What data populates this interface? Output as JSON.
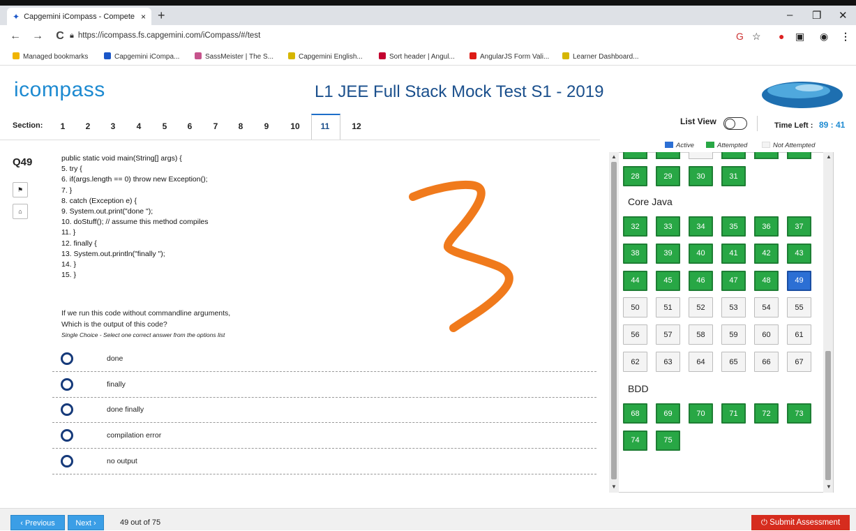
{
  "browser": {
    "tab_title": "Capgemini iCompass - Compete",
    "tab_close": "×",
    "new_tab": "+",
    "minimize": "–",
    "maximize": "❐",
    "close": "✕",
    "back": "←",
    "forward": "→",
    "reload": "C",
    "url": "https://icompass.fs.capgemini.com/iCompass/#/test",
    "bookmarks": [
      {
        "label": "Managed bookmarks",
        "color": "#f0b400"
      },
      {
        "label": "Capgemini iCompa...",
        "color": "#1a56c8"
      },
      {
        "label": "SassMeister | The S...",
        "color": "#c6538c"
      },
      {
        "label": "Capgemini English...",
        "color": "#d6b600"
      },
      {
        "label": "Sort header | Angul...",
        "color": "#c3002f"
      },
      {
        "label": "AngularJS Form Vali...",
        "color": "#dd1b16"
      },
      {
        "label": "Learner Dashboard...",
        "color": "#d6b600"
      }
    ]
  },
  "header": {
    "logo": "icompass",
    "title": "L1 JEE Full Stack Mock Test S1 - 2019"
  },
  "sections": {
    "label": "Section:",
    "items": [
      "1",
      "2",
      "3",
      "4",
      "5",
      "6",
      "7",
      "8",
      "9",
      "10",
      "11",
      "12"
    ],
    "active": "11"
  },
  "toolbar": {
    "list_view": "List View",
    "time_left_label": "Time Left :",
    "time_left_value": "89 : 41"
  },
  "question": {
    "number": "Q49",
    "code": [
      "public static void main(String[] args) {",
      "5. try {",
      "6. if(args.length == 0) throw new Exception();",
      "7. }",
      "8. catch (Exception e) {",
      "9. System.out.print(\"done \");",
      "10. doStuff(); // assume this method compiles",
      "11. }",
      "12. finally {",
      "13. System.out.println(\"finally \");",
      "14. }",
      "15. }"
    ],
    "text_line1": "If we run this code without commandline arguments,",
    "text_line2": "Which is the output of this code?",
    "hint": "Single Choice - Select one correct answer from the options list",
    "options": [
      "done",
      "finally",
      "done finally",
      "compilation error",
      "no output"
    ],
    "flag_icon": "flag-icon",
    "home_icon": "home-icon"
  },
  "palette": {
    "legend": {
      "active": "Active",
      "attempted": "Attempted",
      "not_attempted": "Not Attempted"
    },
    "colors": {
      "attempted": "#28a745",
      "active": "#2c6fd4",
      "not_attempted": "#f4f4f4"
    },
    "top_row": [
      "28",
      "29",
      "30",
      "31"
    ],
    "categories": [
      {
        "name": "Core Java",
        "rows": [
          [
            {
              "n": "32",
              "s": "att"
            },
            {
              "n": "33",
              "s": "att"
            },
            {
              "n": "34",
              "s": "att"
            },
            {
              "n": "35",
              "s": "att"
            },
            {
              "n": "36",
              "s": "att"
            },
            {
              "n": "37",
              "s": "att"
            }
          ],
          [
            {
              "n": "38",
              "s": "att"
            },
            {
              "n": "39",
              "s": "att"
            },
            {
              "n": "40",
              "s": "att"
            },
            {
              "n": "41",
              "s": "att"
            },
            {
              "n": "42",
              "s": "att"
            },
            {
              "n": "43",
              "s": "att"
            }
          ],
          [
            {
              "n": "44",
              "s": "att"
            },
            {
              "n": "45",
              "s": "att"
            },
            {
              "n": "46",
              "s": "att"
            },
            {
              "n": "47",
              "s": "att"
            },
            {
              "n": "48",
              "s": "att"
            },
            {
              "n": "49",
              "s": "act"
            }
          ],
          [
            {
              "n": "50",
              "s": "not"
            },
            {
              "n": "51",
              "s": "not"
            },
            {
              "n": "52",
              "s": "not"
            },
            {
              "n": "53",
              "s": "not"
            },
            {
              "n": "54",
              "s": "not"
            },
            {
              "n": "55",
              "s": "not"
            }
          ],
          [
            {
              "n": "56",
              "s": "not"
            },
            {
              "n": "57",
              "s": "not"
            },
            {
              "n": "58",
              "s": "not"
            },
            {
              "n": "59",
              "s": "not"
            },
            {
              "n": "60",
              "s": "not"
            },
            {
              "n": "61",
              "s": "not"
            }
          ],
          [
            {
              "n": "62",
              "s": "not"
            },
            {
              "n": "63",
              "s": "not"
            },
            {
              "n": "64",
              "s": "not"
            },
            {
              "n": "65",
              "s": "not"
            },
            {
              "n": "66",
              "s": "not"
            },
            {
              "n": "67",
              "s": "not"
            }
          ]
        ]
      },
      {
        "name": "BDD",
        "rows": [
          [
            {
              "n": "68",
              "s": "att"
            },
            {
              "n": "69",
              "s": "att"
            },
            {
              "n": "70",
              "s": "att"
            },
            {
              "n": "71",
              "s": "att"
            },
            {
              "n": "72",
              "s": "att"
            },
            {
              "n": "73",
              "s": "att"
            }
          ],
          [
            {
              "n": "74",
              "s": "att"
            },
            {
              "n": "75",
              "s": "att"
            }
          ]
        ]
      }
    ]
  },
  "footer": {
    "previous": "‹ Previous",
    "next": "Next ›",
    "progress": "49 out of 75",
    "submit": "⏻ Submit Assessment"
  }
}
